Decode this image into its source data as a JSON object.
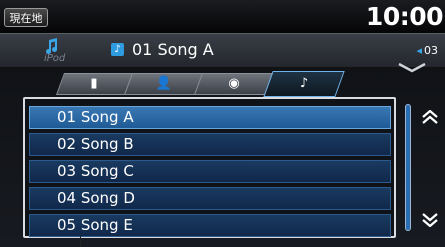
{
  "header": {
    "home_button": "現在地",
    "clock": "10:00"
  },
  "now_playing": {
    "source_icon": "ipod-icon",
    "source_label": "iPod",
    "title": "01  Song A",
    "track_count": "03"
  },
  "tabs": [
    {
      "name": "playlist-tab",
      "icon": "playlist-icon",
      "active": false
    },
    {
      "name": "artist-tab",
      "icon": "artist-icon",
      "active": false
    },
    {
      "name": "album-tab",
      "icon": "album-icon",
      "active": false
    },
    {
      "name": "song-tab",
      "icon": "music-note-icon",
      "active": true
    }
  ],
  "songs": [
    {
      "label": "01  Song A",
      "selected": true
    },
    {
      "label": "02  Song B",
      "selected": false
    },
    {
      "label": "03  Song C",
      "selected": false
    },
    {
      "label": "04  Song D",
      "selected": false
    },
    {
      "label": "05  Song E",
      "selected": false
    }
  ],
  "colors": {
    "accent": "#3aa6e6",
    "selected_row": "#2f6fae",
    "row": "#133258"
  }
}
